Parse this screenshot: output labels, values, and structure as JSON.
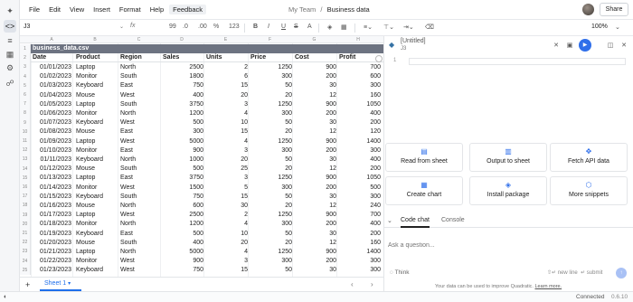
{
  "menu": [
    "File",
    "Edit",
    "View",
    "Insert",
    "Format",
    "Help",
    "Feedback"
  ],
  "doc": {
    "team": "My Team",
    "separator": "/",
    "file": "Business data"
  },
  "share_label": "Share",
  "formula": {
    "cell_ref": "J3",
    "fx": "fx",
    "zoom": "100%"
  },
  "toolbar": {
    "format_items": [
      "99",
      ".0",
      ".00",
      "%",
      "123"
    ],
    "text_items": [
      "B",
      "I",
      "U",
      "S"
    ]
  },
  "columns": [
    "A",
    "B",
    "C",
    "D",
    "E",
    "F",
    "G",
    "H"
  ],
  "table_name": "business_data.csv",
  "headers": [
    "Date",
    "Product",
    "Region",
    "Sales",
    "Units",
    "Price",
    "Cost",
    "Profit"
  ],
  "rows": [
    [
      "01/01/2023",
      "Laptop",
      "North",
      "2500",
      "2",
      "1250",
      "900",
      "700"
    ],
    [
      "01/02/2023",
      "Monitor",
      "South",
      "1800",
      "6",
      "300",
      "200",
      "600"
    ],
    [
      "01/03/2023",
      "Keyboard",
      "East",
      "750",
      "15",
      "50",
      "30",
      "300"
    ],
    [
      "01/04/2023",
      "Mouse",
      "West",
      "400",
      "20",
      "20",
      "12",
      "160"
    ],
    [
      "01/05/2023",
      "Laptop",
      "South",
      "3750",
      "3",
      "1250",
      "900",
      "1050"
    ],
    [
      "01/06/2023",
      "Monitor",
      "North",
      "1200",
      "4",
      "300",
      "200",
      "400"
    ],
    [
      "01/07/2023",
      "Keyboard",
      "West",
      "500",
      "10",
      "50",
      "30",
      "200"
    ],
    [
      "01/08/2023",
      "Mouse",
      "East",
      "300",
      "15",
      "20",
      "12",
      "120"
    ],
    [
      "01/09/2023",
      "Laptop",
      "West",
      "5000",
      "4",
      "1250",
      "900",
      "1400"
    ],
    [
      "01/10/2023",
      "Monitor",
      "East",
      "900",
      "3",
      "300",
      "200",
      "300"
    ],
    [
      "01/11/2023",
      "Keyboard",
      "North",
      "1000",
      "20",
      "50",
      "30",
      "400"
    ],
    [
      "01/12/2023",
      "Mouse",
      "South",
      "500",
      "25",
      "20",
      "12",
      "200"
    ],
    [
      "01/13/2023",
      "Laptop",
      "East",
      "3750",
      "3",
      "1250",
      "900",
      "1050"
    ],
    [
      "01/14/2023",
      "Monitor",
      "West",
      "1500",
      "5",
      "300",
      "200",
      "500"
    ],
    [
      "01/15/2023",
      "Keyboard",
      "South",
      "750",
      "15",
      "50",
      "30",
      "300"
    ],
    [
      "01/16/2023",
      "Mouse",
      "North",
      "600",
      "30",
      "20",
      "12",
      "240"
    ],
    [
      "01/17/2023",
      "Laptop",
      "West",
      "2500",
      "2",
      "1250",
      "900",
      "700"
    ],
    [
      "01/18/2023",
      "Monitor",
      "North",
      "1200",
      "4",
      "300",
      "200",
      "400"
    ],
    [
      "01/19/2023",
      "Keyboard",
      "East",
      "500",
      "10",
      "50",
      "30",
      "200"
    ],
    [
      "01/20/2023",
      "Mouse",
      "South",
      "400",
      "20",
      "20",
      "12",
      "160"
    ],
    [
      "01/21/2023",
      "Laptop",
      "North",
      "5000",
      "4",
      "1250",
      "900",
      "1400"
    ],
    [
      "01/22/2023",
      "Monitor",
      "West",
      "900",
      "3",
      "300",
      "200",
      "300"
    ],
    [
      "01/23/2023",
      "Keyboard",
      "West",
      "750",
      "15",
      "50",
      "30",
      "300"
    ]
  ],
  "row_numbers": [
    "1",
    "2",
    "3",
    "4",
    "5",
    "6",
    "7",
    "8",
    "9",
    "10",
    "11",
    "12",
    "13",
    "14",
    "15",
    "16",
    "17",
    "18",
    "19",
    "20",
    "21",
    "22",
    "23",
    "24",
    "25"
  ],
  "sheet_tab": "Sheet 1",
  "add_sheet": "+",
  "code_panel": {
    "title": "[Untitled]",
    "subtitle": "J3",
    "line_number": "1"
  },
  "actions": [
    {
      "label": "Read from sheet",
      "icon": "table-icon"
    },
    {
      "label": "Output to sheet",
      "icon": "table-output-icon"
    },
    {
      "label": "Fetch API data",
      "icon": "api-icon"
    },
    {
      "label": "Create chart",
      "icon": "chart-icon"
    },
    {
      "label": "Install package",
      "icon": "package-icon"
    },
    {
      "label": "More snippets",
      "icon": "snippets-icon"
    }
  ],
  "chat": {
    "tabs": [
      "Code chat",
      "Console"
    ],
    "placeholder": "Ask a question...",
    "think": "Think",
    "new_line_hint": "new line",
    "submit_hint": "submit",
    "disclaimer_text": "Your data can be used to improve Quadratic.",
    "learn_more": "Learn more."
  },
  "status": {
    "connected": "Connected",
    "version": "0.6.10"
  },
  "colors": {
    "accent": "#2f6fea",
    "table_header": "#6d7381"
  }
}
